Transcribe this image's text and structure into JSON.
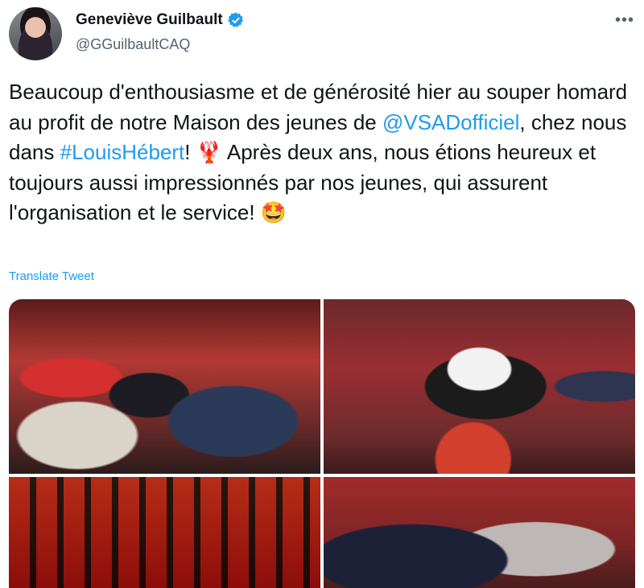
{
  "author": {
    "name": "Geneviève Guilbault",
    "handle": "@GGuilbaultCAQ",
    "verified": true,
    "avatar_icon": "avatar"
  },
  "menu": {
    "more_label": "•••"
  },
  "tweet": {
    "seg1": "Beaucoup d'enthousiasme et de générosité hier au souper homard au profit de notre Maison des jeunes de ",
    "mention": "@VSADofficiel",
    "seg2": ", chez nous dans ",
    "hashtag": "#LouisHébert",
    "seg3": "! 🦞 Après deux ans, nous étions heureux et toujours aussi impressionnés par nos jeunes, qui assurent l'organisation et le service! 🤩"
  },
  "translate_label": "Translate Tweet",
  "colors": {
    "accent": "#1d9bf0",
    "text": "#0f1419",
    "muted": "#536471"
  },
  "media": {
    "photo_count": 4
  }
}
